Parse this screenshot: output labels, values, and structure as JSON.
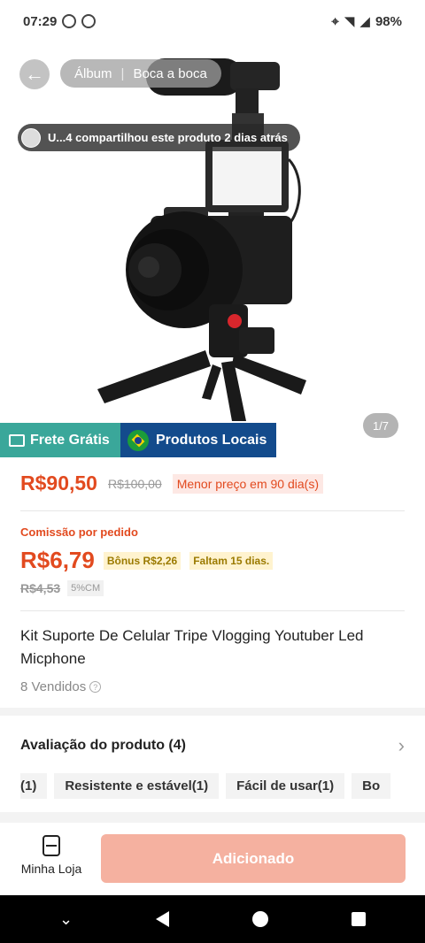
{
  "status_bar": {
    "time": "07:29",
    "battery": "98%"
  },
  "header": {
    "tabs": [
      "Álbum",
      "Boca a boca"
    ],
    "share_text": "U...4 compartilhou este produto 2 dias atrás",
    "image_counter": "1/7"
  },
  "banners": {
    "free_shipping": "Frete Grátis",
    "local_products": "Produtos Locais"
  },
  "price": {
    "current": "R$90,50",
    "original": "R$100,00",
    "badge": "Menor preço em 90 dia(s)"
  },
  "commission": {
    "label": "Comissão por pedido",
    "value": "R$6,79",
    "bonus": "Bônus R$2,26",
    "days_left": "Faltam 15 dias.",
    "old_value": "R$4,53",
    "rate": "5%CM"
  },
  "product": {
    "title": "Kit Suporte De Celular Tripe Vlogging Youtuber Led Micphone",
    "sold": "8 Vendidos"
  },
  "reviews": {
    "heading": "Avaliação do produto (4)",
    "tags": [
      "(1)",
      "Resistente e estável(1)",
      "Fácil de usar(1)",
      "Bo"
    ]
  },
  "bottom": {
    "store_label": "Minha Loja",
    "add_button": "Adicionado"
  },
  "colors": {
    "accent": "#e24a1f",
    "teal": "#3aa79a",
    "navy": "#134b8c",
    "add_button_bg": "#f5b1a0"
  }
}
